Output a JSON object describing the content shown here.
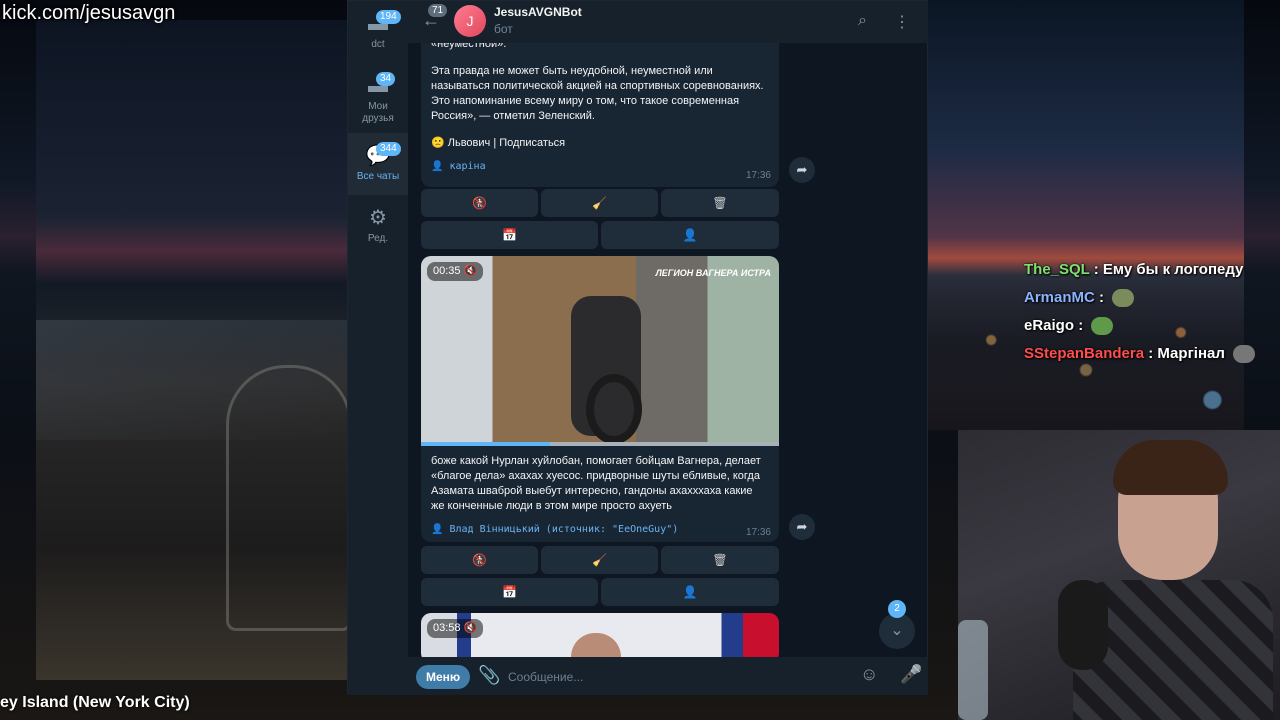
{
  "stream": {
    "url": "kick.com/jesusavgn",
    "location": "ey Island (New York City)"
  },
  "stream_chat": [
    {
      "user": "The_SQL",
      "user_color": "#7ee06e",
      "message": ": Ему бы к логопеду",
      "emote": ""
    },
    {
      "user": "ArmanMC",
      "user_color": "#8ab4ff",
      "message": ":",
      "emote": "emote-icon"
    },
    {
      "user": "eRaigo",
      "user_color": "#ffffff",
      "message": ":",
      "emote": "emote-icon"
    },
    {
      "user": "SStepanBandera",
      "user_color": "#ff4d4d",
      "message": ": Маргінал",
      "emote": "emote-icon"
    }
  ],
  "sidebar": {
    "folders": [
      {
        "label": "dct",
        "badge": "194",
        "icon": "folder-icon"
      },
      {
        "label": "Мои друзья",
        "badge": "34",
        "icon": "folder-icon"
      },
      {
        "label": "Все чаты",
        "badge": "344",
        "icon": "chats-icon",
        "active": true
      },
      {
        "label": "Ред.",
        "badge": "",
        "icon": "sliders-icon"
      }
    ]
  },
  "header": {
    "back_badge": "71",
    "avatar_letter": "J",
    "title": "JesusAVGNBot",
    "subtitle": "бот"
  },
  "messages": [
    {
      "partial_top": "«неуместной».",
      "body": "Эта правда не может быть неудобной, неуместной или называться политической акцией на спортивных соревнованиях. Это напоминание всему миру о том, что такое современная Россия», — отметил Зеленский.",
      "signature": "🙁 Львович | Подписаться",
      "author": "👤 каріна",
      "time": "17:36"
    },
    {
      "video_duration": "00:35",
      "video_watermark": "ЛЕГИОН ВАГНЕРА ИСТРА",
      "video_progress": 0.36,
      "body": "боже какой Нурлан хуйлобан, помогает бойцам Вагнера, делает «благое дела» ахахах хуесос. придворные шуты еблив­ые, когда Азамата шваброй выебут интересно, гандоны ахахххаха какие же конченные люди в этом мире просто ахуеть",
      "author": "👤 Влад Вінницький (источник: \"EeOneGuy\")",
      "time": "17:36"
    },
    {
      "video_duration": "03:58"
    }
  ],
  "keyboard": {
    "row1": [
      "🚷",
      "🧹",
      "🗑"
    ],
    "row2": [
      "📅",
      "👤"
    ]
  },
  "input": {
    "menu_label": "Меню",
    "placeholder": "Сообщение..."
  },
  "scroll_badge": "2",
  "colors": {
    "accent": "#5eb5f7",
    "bubble": "#182533",
    "bg": "#0e1621",
    "author": "#6ab3f3"
  }
}
